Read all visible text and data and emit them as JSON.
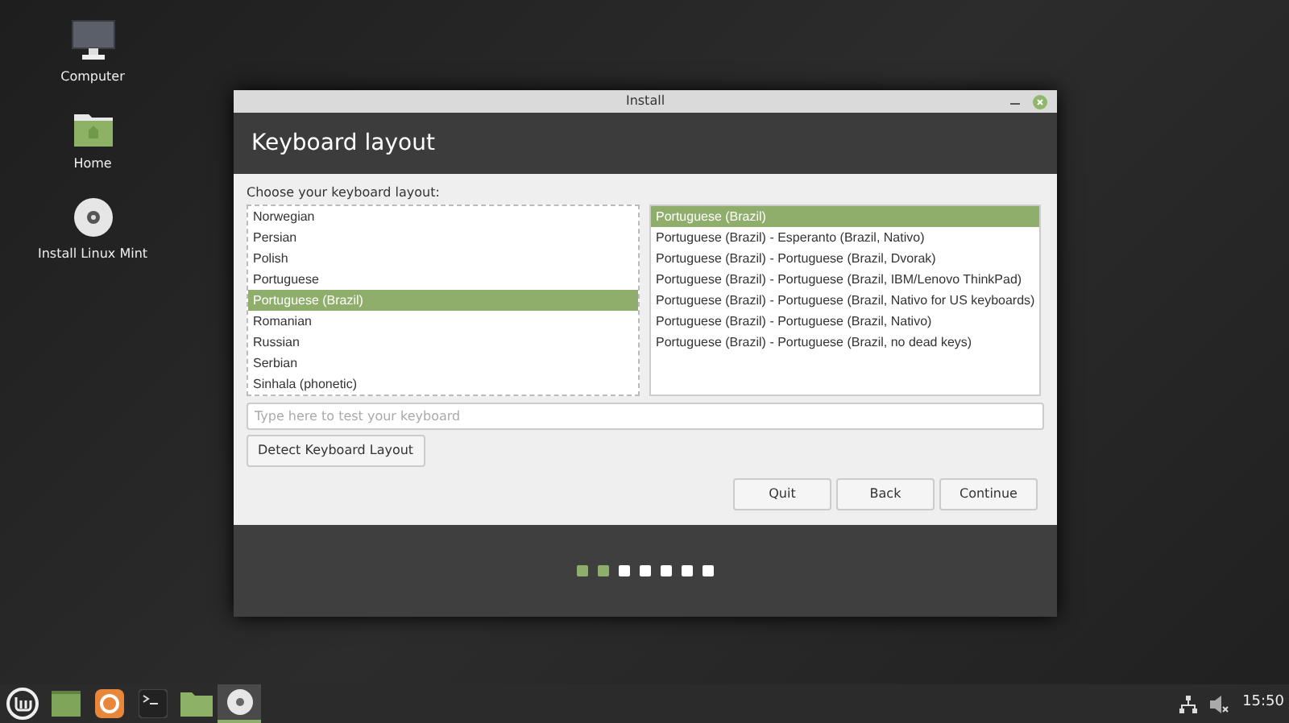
{
  "desktop_icons": [
    {
      "kind": "computer",
      "label": "Computer"
    },
    {
      "kind": "folder",
      "label": "Home"
    },
    {
      "kind": "disc",
      "label": "Install Linux Mint"
    }
  ],
  "window": {
    "title": "Install",
    "heading": "Keyboard layout"
  },
  "prompt": "Choose your keyboard layout:",
  "layouts": [
    {
      "label": "Norwegian",
      "selected": false
    },
    {
      "label": "Persian",
      "selected": false
    },
    {
      "label": "Polish",
      "selected": false
    },
    {
      "label": "Portuguese",
      "selected": false
    },
    {
      "label": "Portuguese (Brazil)",
      "selected": true
    },
    {
      "label": "Romanian",
      "selected": false
    },
    {
      "label": "Russian",
      "selected": false
    },
    {
      "label": "Serbian",
      "selected": false
    },
    {
      "label": "Sinhala (phonetic)",
      "selected": false
    }
  ],
  "variants": [
    {
      "label": "Portuguese (Brazil)",
      "selected": true
    },
    {
      "label": "Portuguese (Brazil) - Esperanto (Brazil, Nativo)",
      "selected": false
    },
    {
      "label": "Portuguese (Brazil) - Portuguese (Brazil, Dvorak)",
      "selected": false
    },
    {
      "label": "Portuguese (Brazil) - Portuguese (Brazil, IBM/Lenovo ThinkPad)",
      "selected": false
    },
    {
      "label": "Portuguese (Brazil) - Portuguese (Brazil, Nativo for US keyboards)",
      "selected": false
    },
    {
      "label": "Portuguese (Brazil) - Portuguese (Brazil, Nativo)",
      "selected": false
    },
    {
      "label": "Portuguese (Brazil) - Portuguese (Brazil, no dead keys)",
      "selected": false
    }
  ],
  "test_field": {
    "placeholder": "Type here to test your keyboard"
  },
  "detect_button": "Detect Keyboard Layout",
  "buttons": [
    "Quit",
    "Back",
    "Continue"
  ],
  "steps": [
    {
      "done": true
    },
    {
      "done": true
    },
    {
      "done": false
    },
    {
      "done": false
    },
    {
      "done": false
    },
    {
      "done": false
    },
    {
      "done": false
    }
  ],
  "taskbar": {
    "items": [
      {
        "kind": "menu",
        "active": false
      },
      {
        "kind": "window",
        "active": false
      },
      {
        "kind": "browser",
        "active": false
      },
      {
        "kind": "terminal",
        "active": false
      },
      {
        "kind": "folder",
        "active": false
      },
      {
        "kind": "disc",
        "active": true
      }
    ],
    "clock": "15:50"
  }
}
